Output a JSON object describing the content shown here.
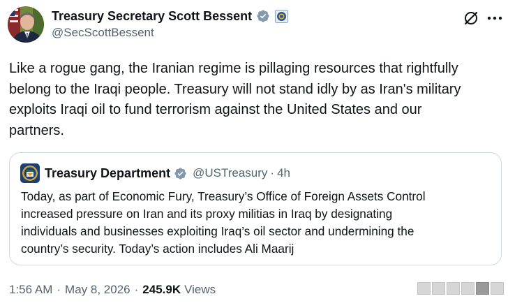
{
  "author": {
    "name": "Treasury Secretary Scott Bessent",
    "handle": "@SecScottBessent",
    "verified": true,
    "badge_color": "#829aab"
  },
  "header_actions": {
    "grok_icon": "grok-icon",
    "more_icon": "more-icon",
    "more_label": "···"
  },
  "tweet": {
    "text": "Like a rogue gang, the Iranian regime is pillaging resources that rightfully\nbelong to the Iraqi people. Treasury will not stand idly by as Iran's military\nexploits Iraqi oil to fund terrorism against the United States and our\npartners."
  },
  "quote": {
    "name": "Treasury Department",
    "handle": "@USTreasury",
    "separator": "·",
    "time": "4h",
    "verified": true,
    "text": "Today, as part of Economic Fury, Treasury’s Office of Foreign Assets Control\nincreased pressure on Iran and its proxy militias in Iraq by designating\nindividuals and businesses exploiting Iraq’s oil sector and undermining the\ncountry’s security. Today’s action includes Ali Maarij"
  },
  "meta": {
    "time": "1:56 AM",
    "separator": "·",
    "date": "May 8, 2026",
    "views_count": "245.9K",
    "views_label": "Views"
  },
  "colors": {
    "text": "#0f1419",
    "secondary": "#536471",
    "border": "#cfd9de",
    "badge": "#829aab"
  }
}
